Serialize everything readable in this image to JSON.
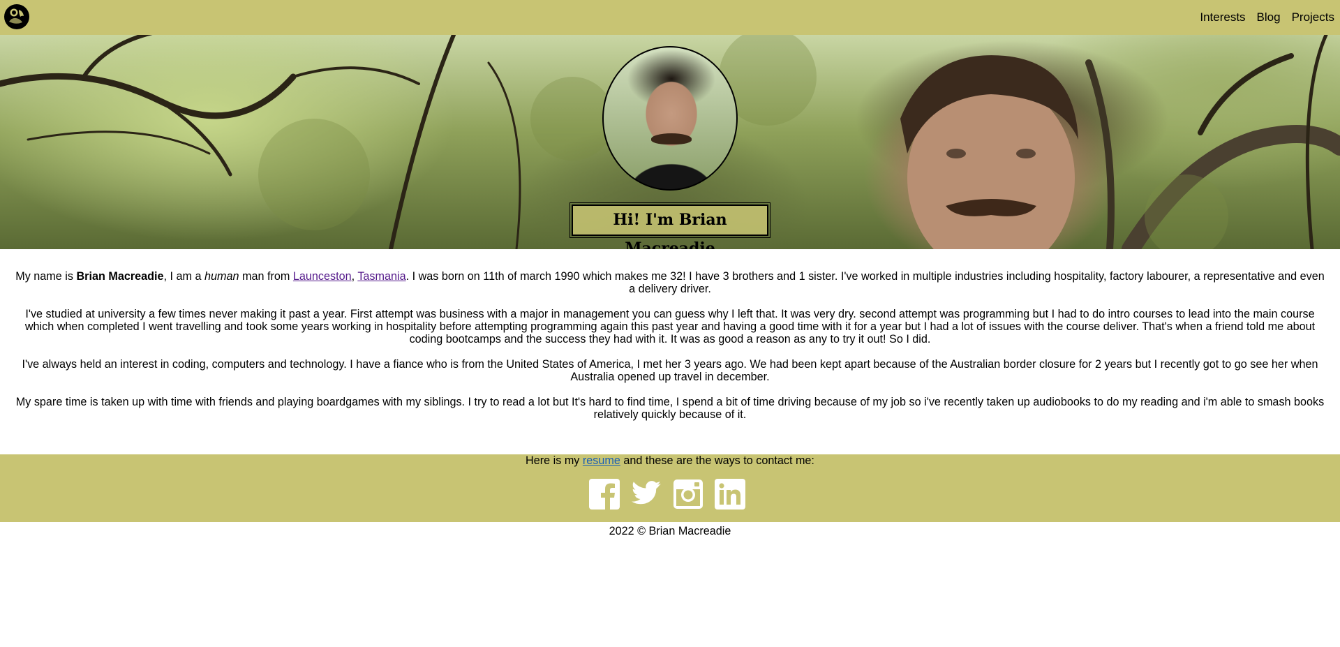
{
  "nav": {
    "logo_icon": "silhouette-logo-icon",
    "links": [
      "Interests",
      "Blog",
      "Projects"
    ]
  },
  "hero": {
    "title": "Hi! I'm Brian Macreadie"
  },
  "bio": {
    "p1": {
      "pre": "My name is ",
      "name": "Brian Macreadie",
      "mid": ", I am a ",
      "human": "human",
      "from": " man from ",
      "city": "Launceston",
      "comma": ", ",
      "state": "Tasmania",
      "rest": ". I was born on 11th of march 1990 which makes me 32! I have 3 brothers and 1 sister. I've worked in multiple industries including hospitality, factory labourer, a representative and even a delivery driver."
    },
    "p2": "I've studied at university a few times never making it past a year. First attempt was business with a major in management you can guess why I left that. It was very dry. second attempt was programming but I had to do intro courses to lead into the main course which when completed I went travelling and took some years working in hospitality before attempting programming again this past year and having a good time with it for a year but I had a lot of issues with the course deliver. That's when a friend told me about coding bootcamps and the success they had with it. It was as good a reason as any to try it out! So I did.",
    "p3": "I've always held an interest in coding, computers and technology. I have a fiance who is from the United States of America, I met her 3 years ago. We had been kept apart because of the Australian border closure for 2 years but I recently got to go see her when Australia opened up travel in december.",
    "p4": "My spare time is taken up with time with friends and playing boardgames with my siblings. I try to read a lot but It's hard to find time, I spend a bit of time driving because of my job so i've recently taken up audiobooks to do my reading and i'm able to smash books relatively quickly because of it."
  },
  "footer": {
    "contact_pre": "Here is my ",
    "resume": "resume",
    "contact_post": " and these are the ways to contact me:",
    "socials": [
      "facebook-icon",
      "twitter-icon",
      "instagram-icon",
      "linkedin-icon"
    ],
    "copyright": "2022 © Brian Macreadie"
  },
  "colors": {
    "bar": "#c8c473",
    "link_visited": "#551a8b",
    "link": "#1a5fb4"
  }
}
